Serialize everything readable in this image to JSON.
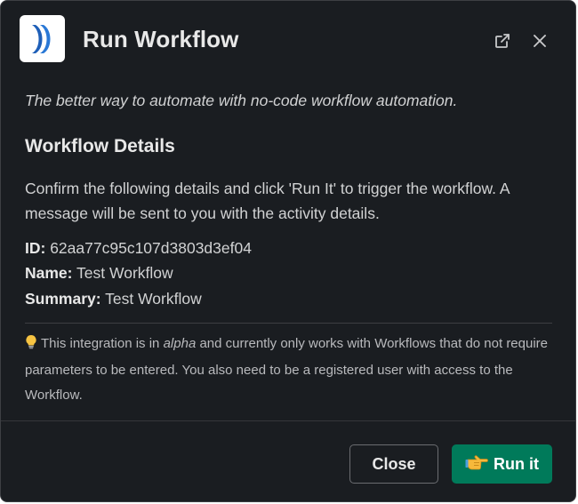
{
  "modal": {
    "title": "Run Workflow",
    "app_logo_icon": "chevron-logo-icon",
    "header_actions": {
      "open_external_icon": "external-link-icon",
      "close_icon": "close-icon"
    }
  },
  "content": {
    "tagline": "The better way to automate with no-code workflow automation.",
    "section_title": "Workflow Details",
    "instructions": "Confirm the following details and click 'Run It' to trigger the workflow. A message will be sent to you with the activity details.",
    "details": {
      "id_label": "ID:",
      "id_value": "62aa77c95c107d3803d3ef04",
      "name_label": "Name:",
      "name_value": "Test Workflow",
      "summary_label": "Summary:",
      "summary_value": "Test Workflow"
    },
    "note": {
      "icon": "lightbulb-icon",
      "text_before": "This integration is in ",
      "text_emphasis": "alpha",
      "text_after": " and currently only works with Workflows that do not require parameters to be entered. You also need to be a registered user with access to the Workflow."
    }
  },
  "footer": {
    "close_label": "Close",
    "run_label": "Run it",
    "run_icon": "pointing-hand-icon"
  },
  "colors": {
    "background": "#1a1d21",
    "primary_button": "#007a5a",
    "text": "#d1d2d3",
    "logo_blue": "#1e5fb8"
  }
}
